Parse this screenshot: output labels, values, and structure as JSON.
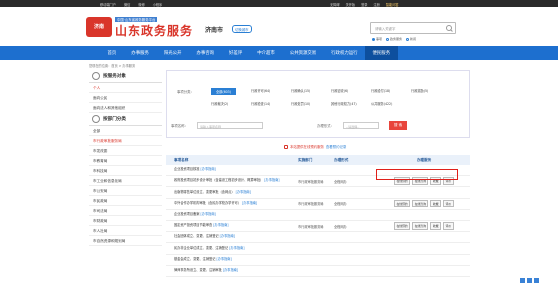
{
  "topbar": {
    "left": [
      "移动端门户",
      "微信",
      "微博",
      "小程序"
    ],
    "right": [
      "无障碍",
      "关怀版",
      "登录",
      "注册",
      "智能问答"
    ]
  },
  "header": {
    "logo_text": "济南",
    "brand_sub": "中国·山东省政务服务平台",
    "brand": "山东政务服务",
    "city": "济南市",
    "city_switch": "切换城市",
    "search_placeholder": "请输入关键字",
    "radios": [
      "事项",
      "政务服务",
      "新闻"
    ]
  },
  "nav": {
    "items": [
      "首页",
      "办事服务",
      "阳光公开",
      "办事咨询",
      "好差评",
      "中介超市",
      "公共资源交易",
      "行政权力运行",
      "便民服务"
    ],
    "active_index": 8
  },
  "breadcrumb": "您现在的位置：首页 > 办事服务",
  "sidebar": {
    "section1": "按服务对象",
    "links1": [
      "个人",
      "面向公民",
      "面向法人和其他组织"
    ],
    "active1": 0,
    "section2": "按部门分类",
    "links2": [
      "全部",
      "市行政审批服务局",
      "市发改委",
      "市教育局",
      "市科技局",
      "市工业和信息化局",
      "市公安局",
      "市民政局",
      "市司法局",
      "市财政局",
      "市人社局",
      "市自然资源和规划局"
    ],
    "active2": 1
  },
  "filter": {
    "type_label": "事项分类：",
    "type_chips": [
      "全部(603)",
      "行政许可(64)",
      "行政确认(15)",
      "行政征收(6)",
      "行政给付(18)",
      "行政奖励(5)",
      "行政裁决(2)",
      "行政检查(14)",
      "行政处罚(10)",
      "其他行政权力(47)",
      "公共服务(422)"
    ],
    "keyword_label": "事项名称：",
    "keyword_placeholder": "请输入事项名称",
    "mode_label": "办理形式：",
    "mode_placeholder": "--请选择--",
    "button": "搜 索"
  },
  "notice": {
    "text": "本站提供在线预约服务",
    "link": "查看预约记录"
  },
  "table": {
    "headers": [
      "事项名称",
      "实施部门",
      "办理形式",
      "办理服务"
    ],
    "guide_label": "[办事指南]",
    "rows": [
      {
        "name": "企业投资项目核准",
        "dept": "",
        "status": "",
        "services": []
      },
      {
        "name": "政府投资项目初步设计审批（含建设工程初步设计、概算审批）",
        "dept": "市行政审批服务局",
        "status": "全程网办",
        "services": [
          "在线预约",
          "在线咨询",
          "收藏",
          "评价"
        ]
      },
      {
        "name": "出版物零售单位设立、变更审批（含网点）",
        "dept": "",
        "status": "",
        "services": []
      },
      {
        "name": "中外合作办学机构审批（含民办学校办学许可）",
        "dept": "市行政审批服务局",
        "status": "全程网办",
        "services": [
          "在线预约",
          "在线咨询",
          "收藏",
          "评价"
        ]
      },
      {
        "name": "企业投资项目备案",
        "dept": "",
        "status": "",
        "services": []
      },
      {
        "name": "固定资产投资项目节能审查",
        "dept": "市行政审批服务局",
        "status": "全程网办",
        "services": [
          "在线预约",
          "在线咨询",
          "收藏",
          "评价"
        ]
      },
      {
        "name": "社会团体成立、变更、注销登记",
        "dept": "",
        "status": "",
        "services": []
      },
      {
        "name": "民办非企业单位成立、变更、注销登记",
        "dept": "",
        "status": "",
        "services": []
      },
      {
        "name": "基金会成立、变更、注销登记",
        "dept": "",
        "status": "",
        "services": []
      },
      {
        "name": "律师事务所设立、变更、注销审批",
        "dept": "",
        "status": "",
        "services": []
      }
    ]
  },
  "colors": {
    "nav_blue": "#1d6fcf",
    "brand_red": "#d9352a",
    "highlight_red": "#e0201a"
  }
}
